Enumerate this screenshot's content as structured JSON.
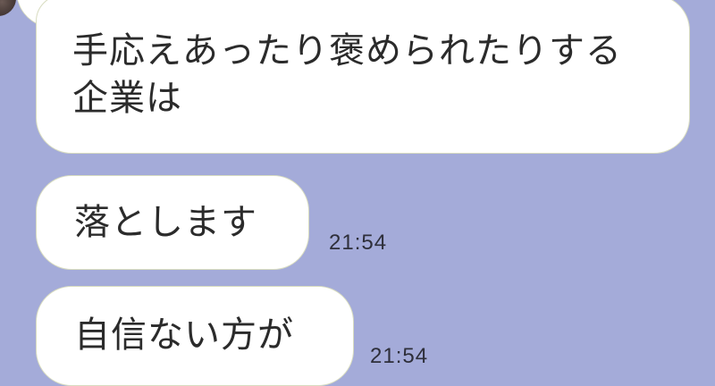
{
  "messages": [
    {
      "text": "手応えあったり褒められたりする\n企業は",
      "time": ""
    },
    {
      "text": "落とします",
      "time": "21:54"
    },
    {
      "text": "自信ない方が",
      "time": "21:54"
    }
  ],
  "colors": {
    "background": "#a4abd9",
    "bubble": "#ffffff",
    "bubble_border": "#d8dcc0",
    "text": "#2b2b2b"
  }
}
